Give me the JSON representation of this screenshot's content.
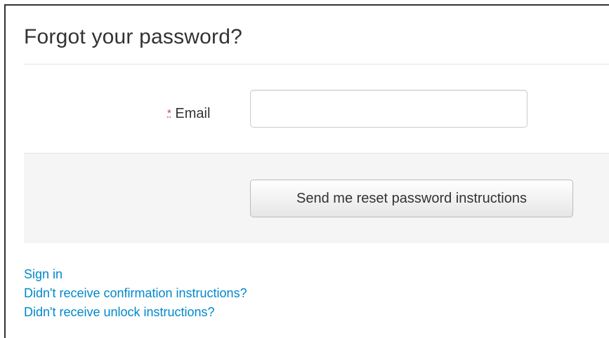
{
  "page": {
    "title": "Forgot your password?"
  },
  "form": {
    "required_marker": "*",
    "email_label": "Email",
    "email_value": "",
    "submit_label": "Send me reset password instructions"
  },
  "links": {
    "sign_in": "Sign in",
    "confirmation": "Didn't receive confirmation instructions?",
    "unlock": "Didn't receive unlock instructions?"
  },
  "colors": {
    "link": "#0088cc",
    "required": "#b94a48",
    "panel_background": "#f5f5f5",
    "text": "#333333"
  }
}
